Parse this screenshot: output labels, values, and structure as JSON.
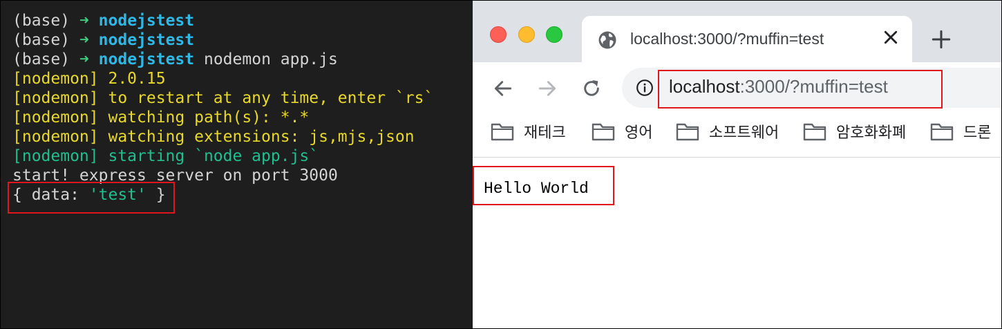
{
  "terminal": {
    "lines": [
      {
        "prefix": "(base) ",
        "arrow": "➜",
        "dir": "nodejstest",
        "cmd": ""
      },
      {
        "prefix": "(base) ",
        "arrow": "➜",
        "dir": "nodejstest",
        "cmd": ""
      },
      {
        "prefix": "(base) ",
        "arrow": "➜",
        "dir": "nodejstest",
        "cmd": " nodemon app.js"
      }
    ],
    "nodemon_version": "[nodemon] 2.0.15",
    "nodemon_restart": "[nodemon] to restart at any time, enter `rs`",
    "nodemon_paths": "[nodemon] watching path(s): *.*",
    "nodemon_ext": "[nodemon] watching extensions: js,mjs,json",
    "nodemon_start": "[nodemon] starting `node app.js`",
    "server_start": "start! express server on port 3000",
    "data_open": "{ data: ",
    "data_value": "'test'",
    "data_close": " }"
  },
  "browser": {
    "tab_title": "localhost:3000/?muffin=test",
    "url_host": "localhost",
    "url_rest": ":3000/?muffin=test",
    "bookmarks": [
      "재테크",
      "영어",
      "소프트웨어",
      "암호화화폐",
      "드론"
    ],
    "page_text": "Hello World"
  },
  "colors": {
    "terminal_bg": "#1e1e1e",
    "prompt_dir": "#2fb8e6",
    "nodemon_yellow": "#e8d829",
    "nodemon_green": "#1fbf90",
    "highlight_red": "#e0161c"
  }
}
